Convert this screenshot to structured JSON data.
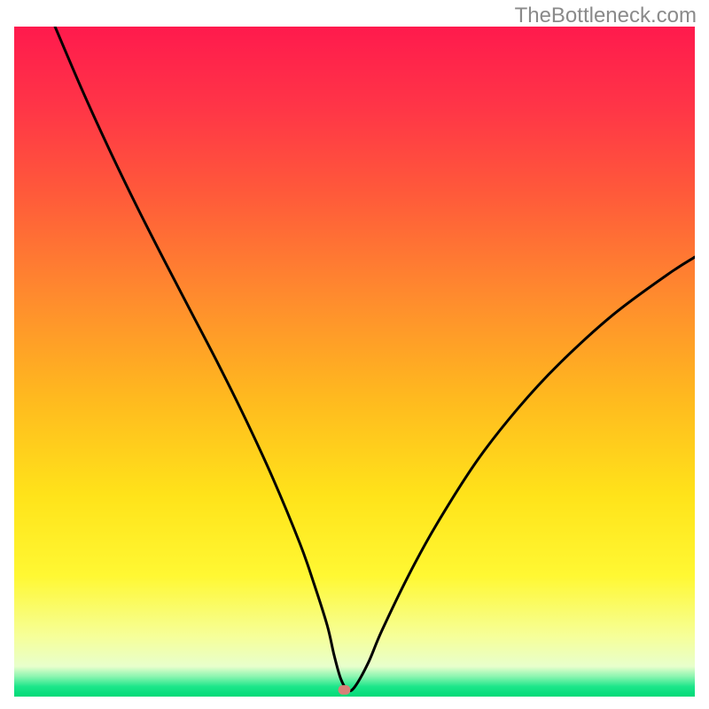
{
  "watermark": "TheBottleneck.com",
  "chart_data": {
    "type": "line",
    "title": "",
    "xlabel": "",
    "ylabel": "",
    "xlim": [
      0,
      100
    ],
    "ylim": [
      0,
      100
    ],
    "grid": false,
    "legend": false,
    "background_gradient_stops": [
      {
        "offset": 0.0,
        "color": "#ff1a4d"
      },
      {
        "offset": 0.12,
        "color": "#ff3547"
      },
      {
        "offset": 0.25,
        "color": "#ff5a3a"
      },
      {
        "offset": 0.4,
        "color": "#ff8a2e"
      },
      {
        "offset": 0.55,
        "color": "#ffb81f"
      },
      {
        "offset": 0.7,
        "color": "#ffe31a"
      },
      {
        "offset": 0.82,
        "color": "#fff833"
      },
      {
        "offset": 0.91,
        "color": "#f6ff99"
      },
      {
        "offset": 0.955,
        "color": "#e8ffcc"
      },
      {
        "offset": 0.97,
        "color": "#8bf5b0"
      },
      {
        "offset": 0.985,
        "color": "#1de68a"
      },
      {
        "offset": 1.0,
        "color": "#00d977"
      }
    ],
    "series": [
      {
        "name": "bottleneck-curve",
        "color": "#000000",
        "x": [
          6,
          10,
          14,
          18,
          22,
          26,
          30,
          34,
          38,
          42,
          44,
          46,
          47,
          48,
          49,
          50,
          52,
          54,
          58,
          62,
          68,
          74,
          80,
          88,
          96,
          100
        ],
        "y": [
          100,
          90.5,
          81.6,
          73.2,
          65.2,
          57.4,
          49.6,
          41.4,
          32.6,
          22.8,
          17.0,
          10.6,
          6.2,
          2.6,
          1.0,
          1.4,
          5.0,
          9.8,
          18.2,
          25.6,
          35.2,
          43.0,
          49.6,
          57.0,
          63.0,
          65.6
        ]
      }
    ],
    "marker": {
      "name": "min-point-marker",
      "x": 48.5,
      "y": 1.0,
      "color": "#d88078",
      "shape": "rounded-rect",
      "width": 1.8,
      "height": 1.4
    }
  }
}
